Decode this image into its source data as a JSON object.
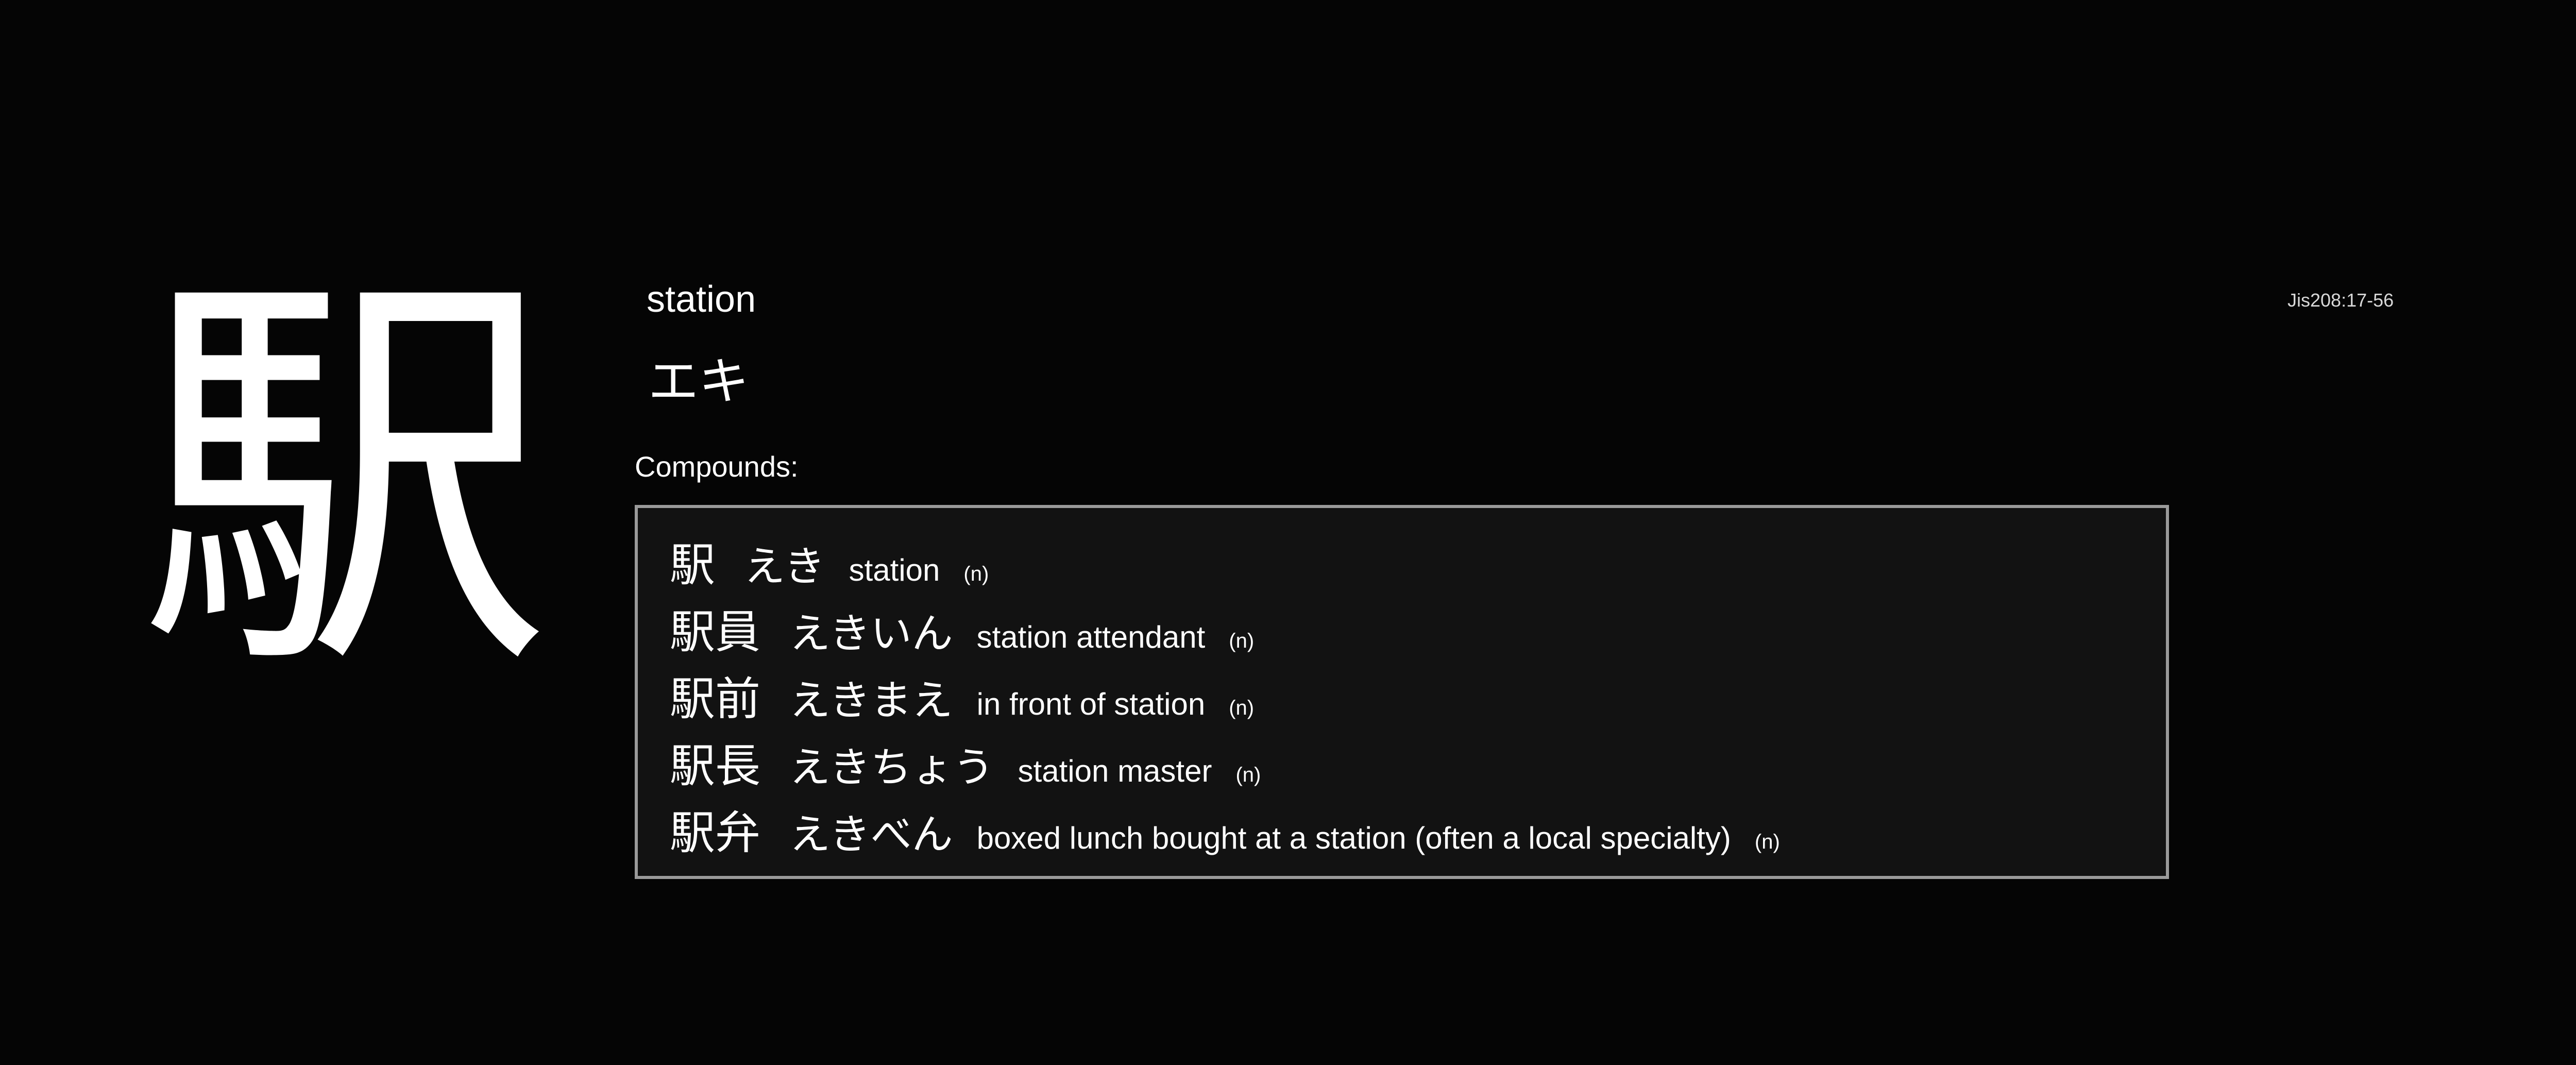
{
  "kanji": "駅",
  "meaning": "station",
  "reading": "エキ",
  "jis_code": "Jis208:17-56",
  "compounds_label": "Compounds:",
  "compounds": [
    {
      "word": "駅",
      "reading": "えき",
      "gloss": "station",
      "pos": "(n)"
    },
    {
      "word": "駅員",
      "reading": "えきいん",
      "gloss": "station attendant",
      "pos": "(n)"
    },
    {
      "word": "駅前",
      "reading": "えきまえ",
      "gloss": "in front of station",
      "pos": "(n)"
    },
    {
      "word": "駅長",
      "reading": "えきちょう",
      "gloss": "station master",
      "pos": "(n)"
    },
    {
      "word": "駅弁",
      "reading": "えきべん",
      "gloss": "boxed lunch bought at a station (often a local specialty)",
      "pos": "(n)"
    }
  ],
  "colors": {
    "background": "#050505",
    "text": "#ffffff",
    "box_background": "#121212",
    "box_border": "#9a9a9a"
  }
}
